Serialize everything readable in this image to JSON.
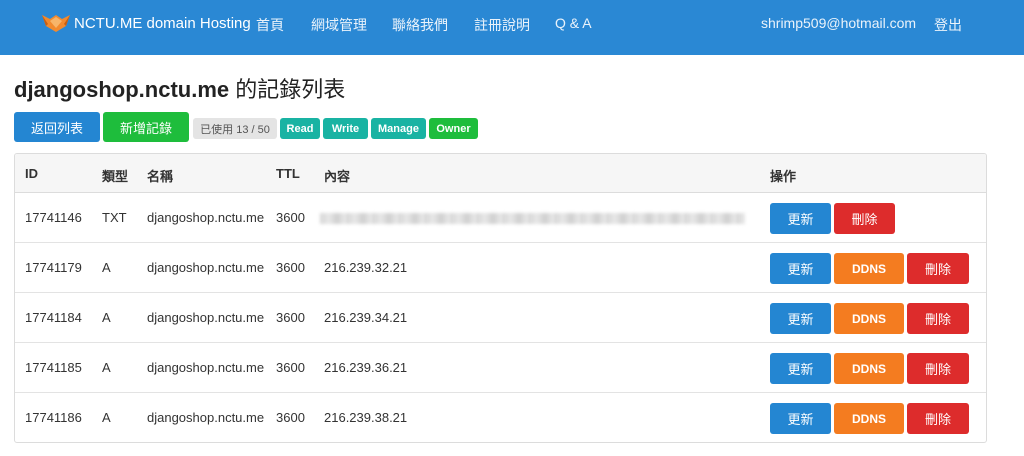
{
  "navbar": {
    "brand": "NCTU.ME domain Hosting",
    "items": [
      "首頁",
      "網域管理",
      "聯絡我們",
      "註冊說明",
      "Q & A"
    ],
    "user_email": "shrimp509@hotmail.com",
    "logout": "登出"
  },
  "page": {
    "domain": "djangoshop.nctu.me",
    "title_suffix": " 的記錄列表"
  },
  "actions": {
    "back": "返回列表",
    "add": "新增記錄"
  },
  "badges": {
    "usage": "已使用 13 / 50",
    "read": "Read",
    "write": "Write",
    "manage": "Manage",
    "owner": "Owner"
  },
  "colors": {
    "navbar": "#2a88d4",
    "blue": "#2486d2",
    "green": "#1ebd3c",
    "teal": "#19b3a3",
    "orange": "#f47c20",
    "red": "#dd2c2c"
  },
  "table": {
    "headers": {
      "id": "ID",
      "type": "類型",
      "name": "名稱",
      "ttl": "TTL",
      "content": "內容",
      "ops": "操作"
    },
    "row_buttons": {
      "update": "更新",
      "ddns": "DDNS",
      "delete": "刪除"
    },
    "rows": [
      {
        "id": "17741146",
        "type": "TXT",
        "name": "djangoshop.nctu.me",
        "ttl": "3600",
        "content": ""
      },
      {
        "id": "17741179",
        "type": "A",
        "name": "djangoshop.nctu.me",
        "ttl": "3600",
        "content": "216.239.32.21"
      },
      {
        "id": "17741184",
        "type": "A",
        "name": "djangoshop.nctu.me",
        "ttl": "3600",
        "content": "216.239.34.21"
      },
      {
        "id": "17741185",
        "type": "A",
        "name": "djangoshop.nctu.me",
        "ttl": "3600",
        "content": "216.239.36.21"
      },
      {
        "id": "17741186",
        "type": "A",
        "name": "djangoshop.nctu.me",
        "ttl": "3600",
        "content": "216.239.38.21"
      }
    ]
  }
}
